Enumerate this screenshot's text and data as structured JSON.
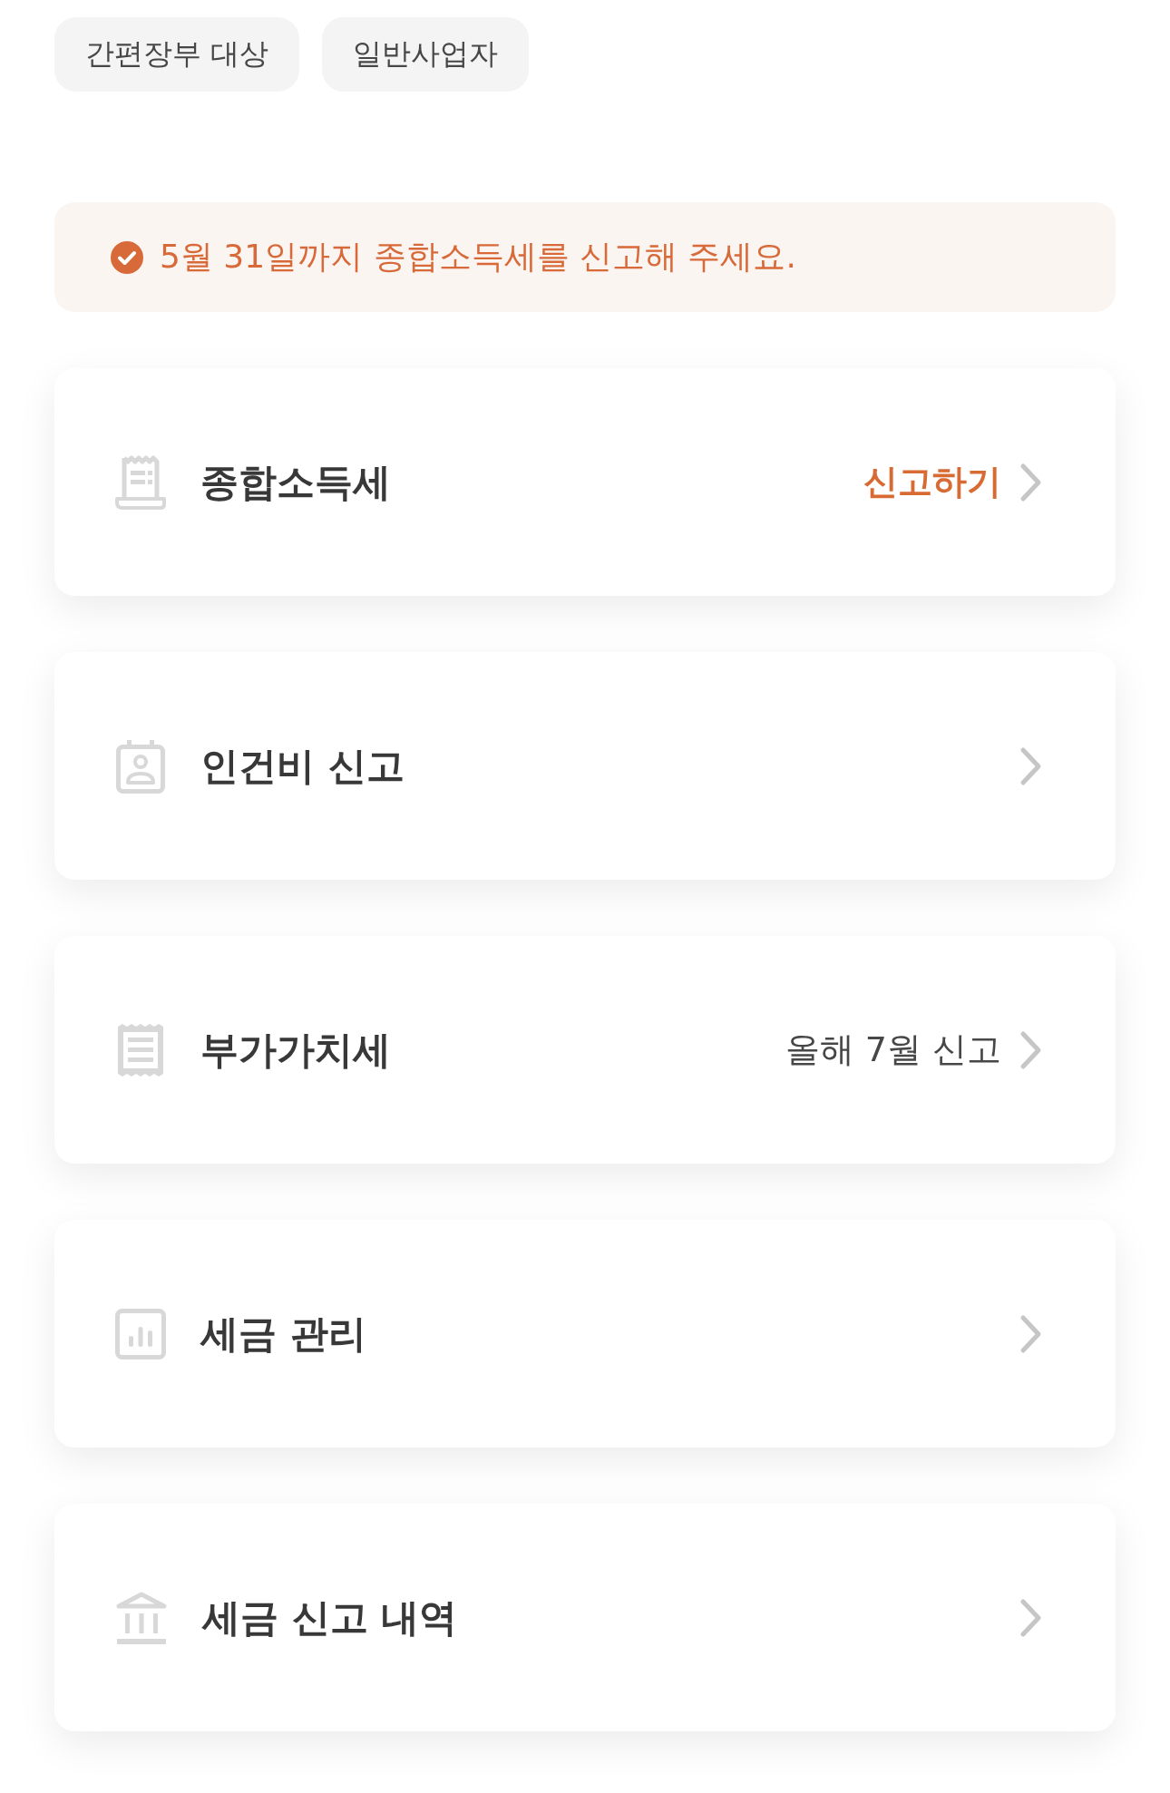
{
  "filter_chips": [
    {
      "label": "간편장부 대상"
    },
    {
      "label": "일반사업자"
    }
  ],
  "notice": {
    "text": "5월 31일까지 종합소득세를 신고해 주세요."
  },
  "menu_items": [
    {
      "title": "종합소득세",
      "action": {
        "text": "신고하기",
        "highlighted": true
      }
    },
    {
      "title": "인건비 신고"
    },
    {
      "title": "부가가치세",
      "action": {
        "text": "올해 7월 신고",
        "highlighted": false
      }
    },
    {
      "title": "세금 관리"
    },
    {
      "title": "세금 신고 내역"
    }
  ]
}
